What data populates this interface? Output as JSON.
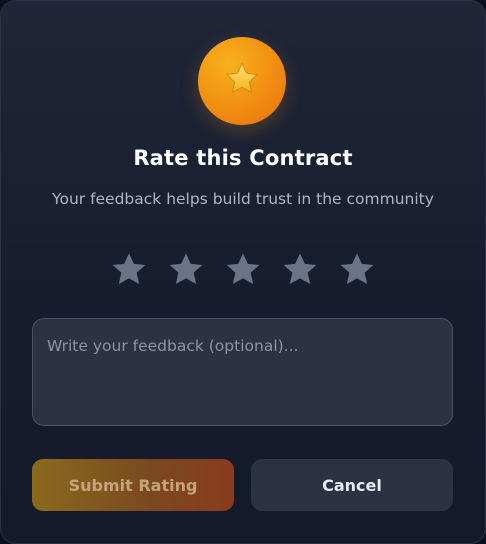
{
  "dialog": {
    "title": "Rate this Contract",
    "subtitle": "Your feedback helps build trust in the community",
    "badge_icon": "star-icon",
    "rating": {
      "max_stars": 5,
      "selected": 0,
      "star_color": "#6b7486"
    },
    "feedback": {
      "placeholder": "Write your feedback (optional)...",
      "value": ""
    },
    "buttons": {
      "submit_label": "Submit Rating",
      "cancel_label": "Cancel"
    },
    "colors": {
      "accent_start": "#f5a623",
      "accent_end": "#ea6f0c",
      "background": "#171e2f"
    }
  }
}
